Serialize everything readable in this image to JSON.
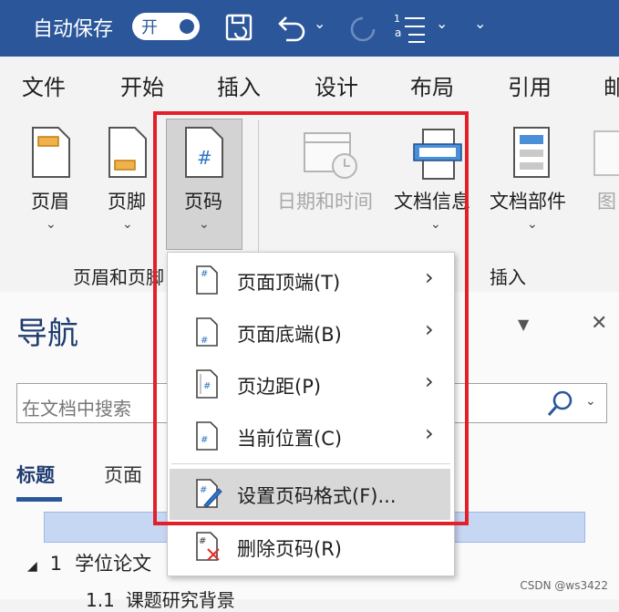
{
  "titlebar": {
    "autosave_label": "自动保存",
    "autosave_toggle": "开"
  },
  "tabs": [
    {
      "label": "文件"
    },
    {
      "label": "开始"
    },
    {
      "label": "插入"
    },
    {
      "label": "设计"
    },
    {
      "label": "布局"
    },
    {
      "label": "引用"
    },
    {
      "label": "邮"
    }
  ],
  "ribbon": {
    "header": "页眉",
    "footer": "页脚",
    "page_number": "页码",
    "date_time": "日期和时间",
    "doc_info": "文档信息",
    "doc_parts": "文档部件",
    "picture": "图",
    "group_header_footer": "页眉和页脚",
    "group_insert": "插入"
  },
  "menu": {
    "items": [
      {
        "label": "页面顶端(T)",
        "has_submenu": true
      },
      {
        "label": "页面底端(B)",
        "has_submenu": true
      },
      {
        "label": "页边距(P)",
        "has_submenu": true
      },
      {
        "label": "当前位置(C)",
        "has_submenu": true
      },
      {
        "label": "设置页码格式(F)...",
        "has_submenu": false,
        "highlighted": true
      },
      {
        "label": "删除页码(R)",
        "has_submenu": false
      }
    ]
  },
  "nav": {
    "title": "导航",
    "search_placeholder": "在文档中搜索",
    "tab_headings": "标题",
    "tab_pages": "页面",
    "tree": [
      {
        "number": "1",
        "label": "学位论文"
      },
      {
        "number": "1.1",
        "label": "课题研究背景"
      }
    ]
  },
  "watermark": "CSDN @ws3422",
  "colors": {
    "accent": "#2b579a",
    "annotation": "#e3202a",
    "highlight": "#c6d7f4"
  }
}
